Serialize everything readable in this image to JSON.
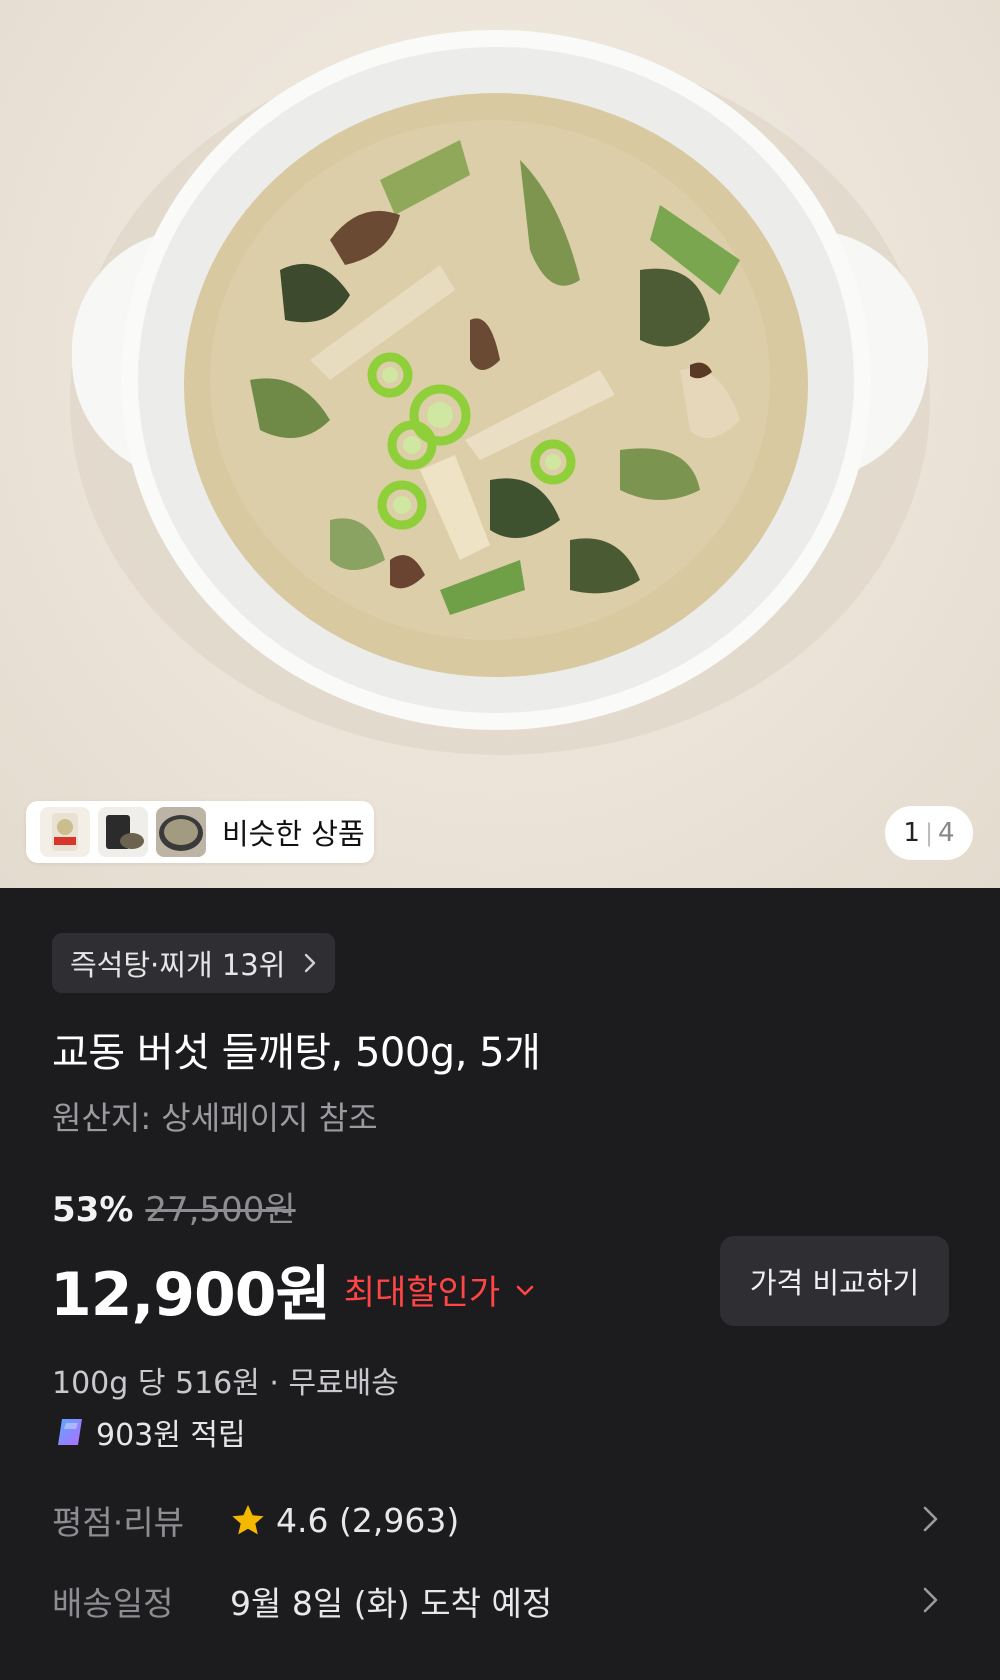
{
  "gallery": {
    "similar_label": "비슷한 상품",
    "page_current": "1",
    "page_separator": "|",
    "page_total": "4"
  },
  "product": {
    "rank_badge": "즉석탕·찌개 13위",
    "title": "교동 버섯 들깨탕, 500g, 5개",
    "origin": "원산지: 상세페이지 참조",
    "discount_percent": "53%",
    "original_price": "27,500원",
    "price": "12,900원",
    "max_discount_label": "최대할인가",
    "compare_button": "가격 비교하기",
    "unit_price_shipping": "100g 당 516원 · 무료배송",
    "points": "903원 적립"
  },
  "meta": {
    "rating_label": "평점·리뷰",
    "rating_value": "4.6 (2,963)",
    "delivery_label": "배송일정",
    "delivery_value": "9월 8일 (화) 도착 예정"
  },
  "colors": {
    "background": "#1c1c1e",
    "discount_red": "#ff4545",
    "star_yellow": "#f5b800",
    "chip_bg": "#2f2f33"
  },
  "icons": {
    "rank_chevron": "chevron-right-icon",
    "discount_chevron": "chevron-down-icon",
    "points": "points-coin-icon",
    "rating": "star-icon",
    "row_chevron": "chevron-right-icon"
  }
}
